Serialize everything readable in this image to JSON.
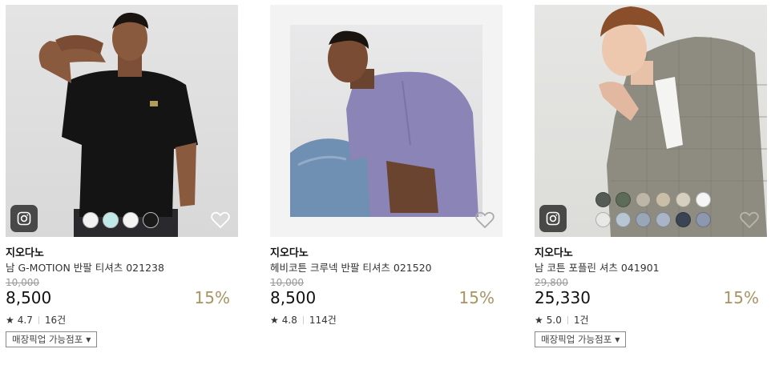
{
  "products": [
    {
      "brand": "지오다노",
      "name": "남 G-MOTION 반팔 티셔츠 021238",
      "original_price": "10,000",
      "price": "8,500",
      "discount": "15%",
      "rating": "4.7",
      "review_count": "16건",
      "pickup_label": "매장픽업 가능점포",
      "swatch_colors": [
        "#f2f2f2",
        "#bfe9e6",
        "#f4f4f4",
        "#1a1a1a"
      ],
      "has_instagram": true
    },
    {
      "brand": "지오다노",
      "name": "헤비코튼 크루넥 반팔 티셔츠 021520",
      "original_price": "10,000",
      "price": "8,500",
      "discount": "15%",
      "rating": "4.8",
      "review_count": "114건",
      "swatch_colors": [],
      "has_instagram": false
    },
    {
      "brand": "지오다노",
      "name": "남 코튼 포플린 셔츠 041901",
      "original_price": "29,800",
      "price": "25,330",
      "discount": "15%",
      "rating": "5.0",
      "review_count": "1건",
      "pickup_label": "매장픽업 가능점포",
      "swatch_colors": [
        "#555b55",
        "#5d6b57",
        "#bdb6a8",
        "#c9bfa9",
        "#d6cfbf",
        "#f5f5f5",
        "#e8e8e6",
        "#b8c6d4",
        "#9aa6b8",
        "#a9b4c6",
        "#3b4452",
        "#8d97ae"
      ],
      "has_instagram": true
    }
  ],
  "colors": {
    "discount": "#a89462",
    "text": "#222222",
    "muted": "#999999"
  },
  "icons": {
    "instagram": "instagram-icon",
    "wishlist": "heart-icon",
    "star": "star-icon",
    "dropdown": "triangle-down-icon"
  }
}
